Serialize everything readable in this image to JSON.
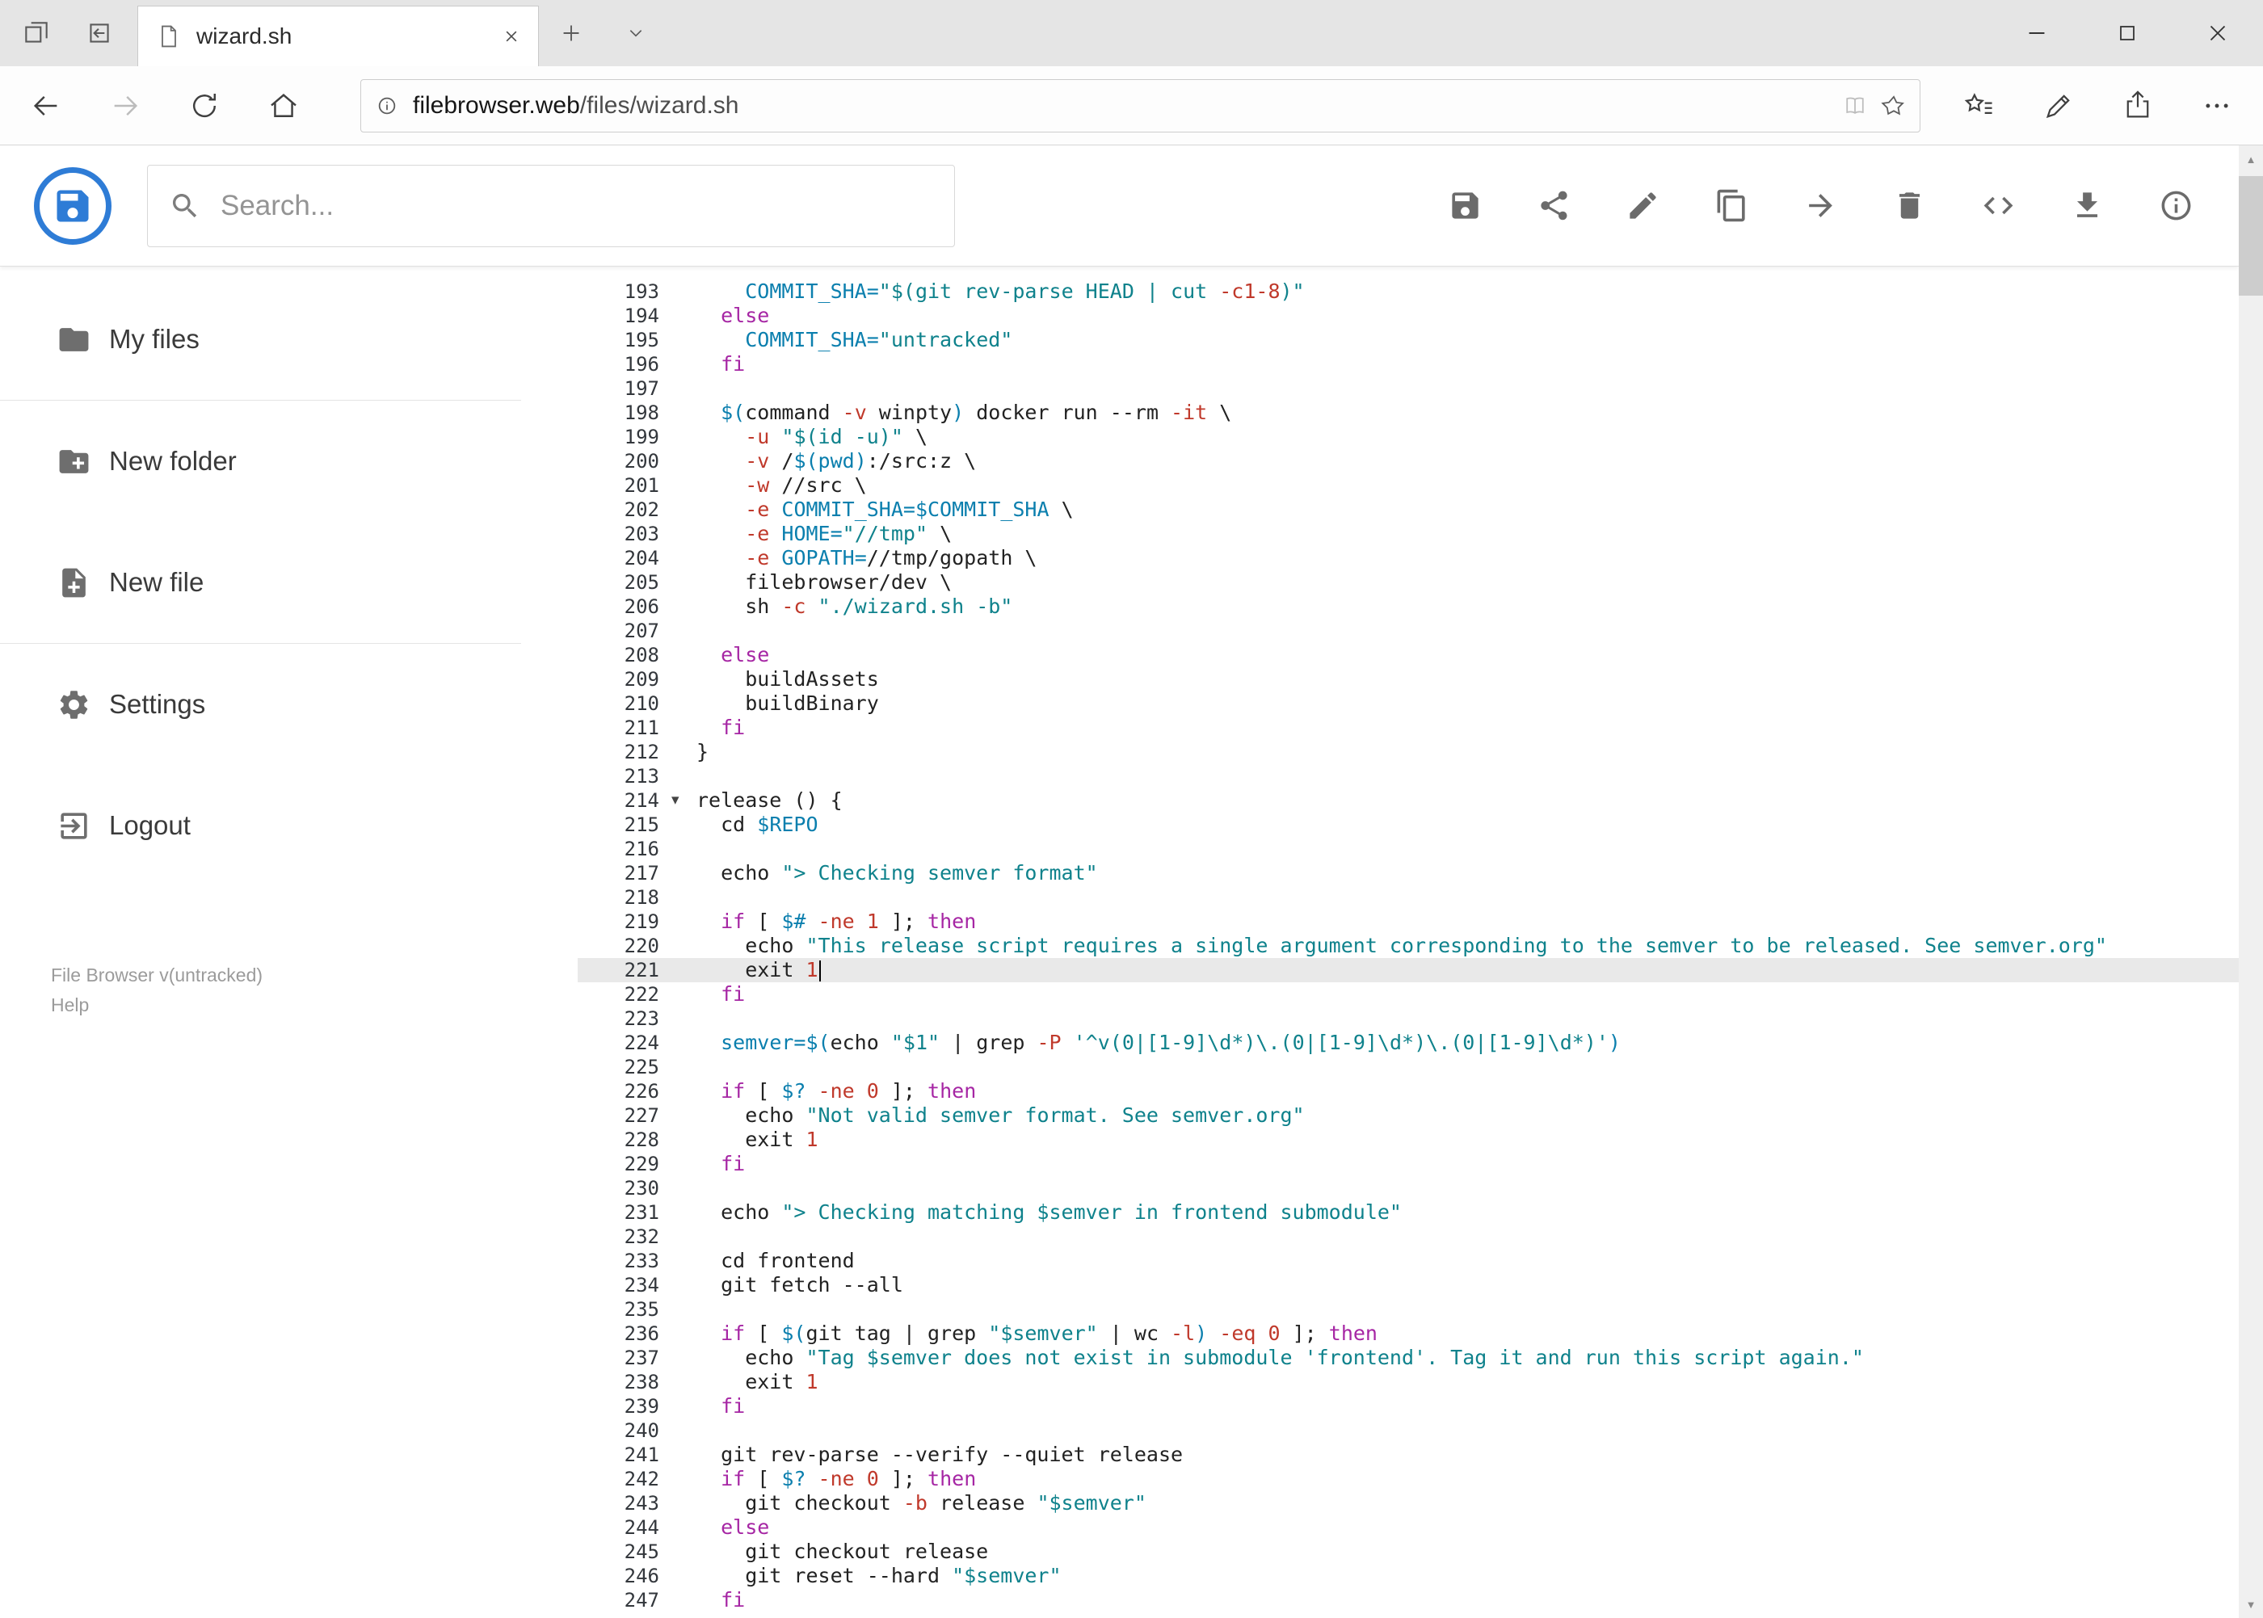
{
  "colors": {
    "accent": "#2e7cd6",
    "keyword": "#a626a4",
    "string": "#0f828c",
    "variable": "#0b7fae",
    "number": "#c0392b",
    "active_line": "#e9e9e9"
  },
  "browser": {
    "tab_title": "wizard.sh",
    "url_domain": "filebrowser.web",
    "url_path": "/files/wizard.sh"
  },
  "header": {
    "search_placeholder": "Search...",
    "toolbar": [
      {
        "id": "save",
        "icon": "floppy"
      },
      {
        "id": "share",
        "icon": "share"
      },
      {
        "id": "rename",
        "icon": "pencil"
      },
      {
        "id": "copy",
        "icon": "copy"
      },
      {
        "id": "move",
        "icon": "arrow-right"
      },
      {
        "id": "delete",
        "icon": "trash"
      },
      {
        "id": "editor",
        "icon": "code"
      },
      {
        "id": "download",
        "icon": "download"
      },
      {
        "id": "info",
        "icon": "info"
      }
    ]
  },
  "sidebar": {
    "items": [
      {
        "id": "my-files",
        "label": "My files",
        "icon": "folder",
        "divider_after": true
      },
      {
        "id": "new-folder",
        "label": "New folder",
        "icon": "folder-plus",
        "divider_after": false
      },
      {
        "id": "new-file",
        "label": "New file",
        "icon": "file-plus",
        "divider_after": true
      },
      {
        "id": "settings",
        "label": "Settings",
        "icon": "gear",
        "divider_after": false
      },
      {
        "id": "logout",
        "label": "Logout",
        "icon": "logout",
        "divider_after": false
      }
    ],
    "footer_version": "File Browser v(untracked)",
    "footer_help": "Help"
  },
  "editor": {
    "first_line": 193,
    "last_line": 247,
    "active_line": 221,
    "cursor_line": 221,
    "fold_marker_line": 214,
    "lines": [
      {
        "n": 193,
        "t": [
          [
            "p",
            "    "
          ],
          [
            "v",
            "COMMIT_SHA="
          ],
          [
            "s",
            "\"$(git rev-parse HEAD | cut "
          ],
          [
            "n",
            "-c1-8"
          ],
          [
            "s",
            ")\""
          ]
        ]
      },
      {
        "n": 194,
        "t": [
          [
            "p",
            "  "
          ],
          [
            "k",
            "else"
          ]
        ]
      },
      {
        "n": 195,
        "t": [
          [
            "p",
            "    "
          ],
          [
            "v",
            "COMMIT_SHA="
          ],
          [
            "s",
            "\"untracked\""
          ]
        ]
      },
      {
        "n": 196,
        "t": [
          [
            "p",
            "  "
          ],
          [
            "k",
            "fi"
          ]
        ]
      },
      {
        "n": 197,
        "t": []
      },
      {
        "n": 198,
        "t": [
          [
            "p",
            "  "
          ],
          [
            "v",
            "$("
          ],
          [
            "p",
            "command "
          ],
          [
            "n",
            "-v"
          ],
          [
            "p",
            " winpty"
          ],
          [
            "v",
            ")"
          ],
          [
            "p",
            " docker run --rm "
          ],
          [
            "n",
            "-it"
          ],
          [
            "p",
            " \\"
          ]
        ]
      },
      {
        "n": 199,
        "t": [
          [
            "p",
            "    "
          ],
          [
            "n",
            "-u"
          ],
          [
            "p",
            " "
          ],
          [
            "s",
            "\"$(id -u)\""
          ],
          [
            "p",
            " \\"
          ]
        ]
      },
      {
        "n": 200,
        "t": [
          [
            "p",
            "    "
          ],
          [
            "n",
            "-v"
          ],
          [
            "p",
            " /"
          ],
          [
            "v",
            "$(pwd)"
          ],
          [
            "p",
            ":/src:z \\"
          ]
        ]
      },
      {
        "n": 201,
        "t": [
          [
            "p",
            "    "
          ],
          [
            "n",
            "-w"
          ],
          [
            "p",
            " //src \\"
          ]
        ]
      },
      {
        "n": 202,
        "t": [
          [
            "p",
            "    "
          ],
          [
            "n",
            "-e"
          ],
          [
            "p",
            " "
          ],
          [
            "v",
            "COMMIT_SHA=$COMMIT_SHA"
          ],
          [
            "p",
            " \\"
          ]
        ]
      },
      {
        "n": 203,
        "t": [
          [
            "p",
            "    "
          ],
          [
            "n",
            "-e"
          ],
          [
            "p",
            " "
          ],
          [
            "v",
            "HOME="
          ],
          [
            "s",
            "\"//tmp\""
          ],
          [
            "p",
            " \\"
          ]
        ]
      },
      {
        "n": 204,
        "t": [
          [
            "p",
            "    "
          ],
          [
            "n",
            "-e"
          ],
          [
            "p",
            " "
          ],
          [
            "v",
            "GOPATH="
          ],
          [
            "p",
            "//tmp/gopath \\"
          ]
        ]
      },
      {
        "n": 205,
        "t": [
          [
            "p",
            "    filebrowser/dev \\"
          ]
        ]
      },
      {
        "n": 206,
        "t": [
          [
            "p",
            "    sh "
          ],
          [
            "n",
            "-c"
          ],
          [
            "p",
            " "
          ],
          [
            "s",
            "\"./wizard.sh -b\""
          ]
        ]
      },
      {
        "n": 207,
        "t": []
      },
      {
        "n": 208,
        "t": [
          [
            "p",
            "  "
          ],
          [
            "k",
            "else"
          ]
        ]
      },
      {
        "n": 209,
        "t": [
          [
            "p",
            "    buildAssets"
          ]
        ]
      },
      {
        "n": 210,
        "t": [
          [
            "p",
            "    buildBinary"
          ]
        ]
      },
      {
        "n": 211,
        "t": [
          [
            "p",
            "  "
          ],
          [
            "k",
            "fi"
          ]
        ]
      },
      {
        "n": 212,
        "t": [
          [
            "p",
            "}"
          ]
        ]
      },
      {
        "n": 213,
        "t": []
      },
      {
        "n": 214,
        "t": [
          [
            "p",
            "release () {"
          ]
        ]
      },
      {
        "n": 215,
        "t": [
          [
            "p",
            "  cd "
          ],
          [
            "v",
            "$REPO"
          ]
        ]
      },
      {
        "n": 216,
        "t": []
      },
      {
        "n": 217,
        "t": [
          [
            "p",
            "  echo "
          ],
          [
            "s",
            "\"> Checking semver format\""
          ]
        ]
      },
      {
        "n": 218,
        "t": []
      },
      {
        "n": 219,
        "t": [
          [
            "p",
            "  "
          ],
          [
            "k",
            "if"
          ],
          [
            "p",
            " [ "
          ],
          [
            "v",
            "$#"
          ],
          [
            "p",
            " "
          ],
          [
            "n",
            "-ne"
          ],
          [
            "p",
            " "
          ],
          [
            "n",
            "1"
          ],
          [
            "p",
            " ]; "
          ],
          [
            "k",
            "then"
          ]
        ]
      },
      {
        "n": 220,
        "t": [
          [
            "p",
            "    echo "
          ],
          [
            "s",
            "\"This release script requires a single argument corresponding to the semver to be released. See semver.org\""
          ]
        ]
      },
      {
        "n": 221,
        "t": [
          [
            "p",
            "    exit "
          ],
          [
            "n",
            "1"
          ]
        ]
      },
      {
        "n": 222,
        "t": [
          [
            "p",
            "  "
          ],
          [
            "k",
            "fi"
          ]
        ]
      },
      {
        "n": 223,
        "t": []
      },
      {
        "n": 224,
        "t": [
          [
            "p",
            "  "
          ],
          [
            "v",
            "semver=$("
          ],
          [
            "p",
            "echo "
          ],
          [
            "s",
            "\"$1\""
          ],
          [
            "p",
            " | grep "
          ],
          [
            "n",
            "-P"
          ],
          [
            "p",
            " "
          ],
          [
            "s",
            "'^v(0|[1-9]\\d*)\\.(0|[1-9]\\d*)\\.(0|[1-9]\\d*)'"
          ],
          [
            "v",
            ")"
          ]
        ]
      },
      {
        "n": 225,
        "t": []
      },
      {
        "n": 226,
        "t": [
          [
            "p",
            "  "
          ],
          [
            "k",
            "if"
          ],
          [
            "p",
            " [ "
          ],
          [
            "v",
            "$?"
          ],
          [
            "p",
            " "
          ],
          [
            "n",
            "-ne"
          ],
          [
            "p",
            " "
          ],
          [
            "n",
            "0"
          ],
          [
            "p",
            " ]; "
          ],
          [
            "k",
            "then"
          ]
        ]
      },
      {
        "n": 227,
        "t": [
          [
            "p",
            "    echo "
          ],
          [
            "s",
            "\"Not valid semver format. See semver.org\""
          ]
        ]
      },
      {
        "n": 228,
        "t": [
          [
            "p",
            "    exit "
          ],
          [
            "n",
            "1"
          ]
        ]
      },
      {
        "n": 229,
        "t": [
          [
            "p",
            "  "
          ],
          [
            "k",
            "fi"
          ]
        ]
      },
      {
        "n": 230,
        "t": []
      },
      {
        "n": 231,
        "t": [
          [
            "p",
            "  echo "
          ],
          [
            "s",
            "\"> Checking matching $semver in frontend submodule\""
          ]
        ]
      },
      {
        "n": 232,
        "t": []
      },
      {
        "n": 233,
        "t": [
          [
            "p",
            "  cd frontend"
          ]
        ]
      },
      {
        "n": 234,
        "t": [
          [
            "p",
            "  git fetch --all"
          ]
        ]
      },
      {
        "n": 235,
        "t": []
      },
      {
        "n": 236,
        "t": [
          [
            "p",
            "  "
          ],
          [
            "k",
            "if"
          ],
          [
            "p",
            " [ "
          ],
          [
            "v",
            "$("
          ],
          [
            "p",
            "git tag | grep "
          ],
          [
            "s",
            "\"$semver\""
          ],
          [
            "p",
            " | wc "
          ],
          [
            "n",
            "-l"
          ],
          [
            "v",
            ")"
          ],
          [
            "p",
            " "
          ],
          [
            "n",
            "-eq"
          ],
          [
            "p",
            " "
          ],
          [
            "n",
            "0"
          ],
          [
            "p",
            " ]; "
          ],
          [
            "k",
            "then"
          ]
        ]
      },
      {
        "n": 237,
        "t": [
          [
            "p",
            "    echo "
          ],
          [
            "s",
            "\"Tag $semver does not exist in submodule 'frontend'. Tag it and run this script again.\""
          ]
        ]
      },
      {
        "n": 238,
        "t": [
          [
            "p",
            "    exit "
          ],
          [
            "n",
            "1"
          ]
        ]
      },
      {
        "n": 239,
        "t": [
          [
            "p",
            "  "
          ],
          [
            "k",
            "fi"
          ]
        ]
      },
      {
        "n": 240,
        "t": []
      },
      {
        "n": 241,
        "t": [
          [
            "p",
            "  git rev-parse --verify --quiet release"
          ]
        ]
      },
      {
        "n": 242,
        "t": [
          [
            "p",
            "  "
          ],
          [
            "k",
            "if"
          ],
          [
            "p",
            " [ "
          ],
          [
            "v",
            "$?"
          ],
          [
            "p",
            " "
          ],
          [
            "n",
            "-ne"
          ],
          [
            "p",
            " "
          ],
          [
            "n",
            "0"
          ],
          [
            "p",
            " ]; "
          ],
          [
            "k",
            "then"
          ]
        ]
      },
      {
        "n": 243,
        "t": [
          [
            "p",
            "    git checkout "
          ],
          [
            "n",
            "-b"
          ],
          [
            "p",
            " release "
          ],
          [
            "s",
            "\"$semver\""
          ]
        ]
      },
      {
        "n": 244,
        "t": [
          [
            "p",
            "  "
          ],
          [
            "k",
            "else"
          ]
        ]
      },
      {
        "n": 245,
        "t": [
          [
            "p",
            "    git checkout release"
          ]
        ]
      },
      {
        "n": 246,
        "t": [
          [
            "p",
            "    git reset --hard "
          ],
          [
            "s",
            "\"$semver\""
          ]
        ]
      },
      {
        "n": 247,
        "t": [
          [
            "p",
            "  "
          ],
          [
            "k",
            "fi"
          ]
        ]
      }
    ]
  }
}
